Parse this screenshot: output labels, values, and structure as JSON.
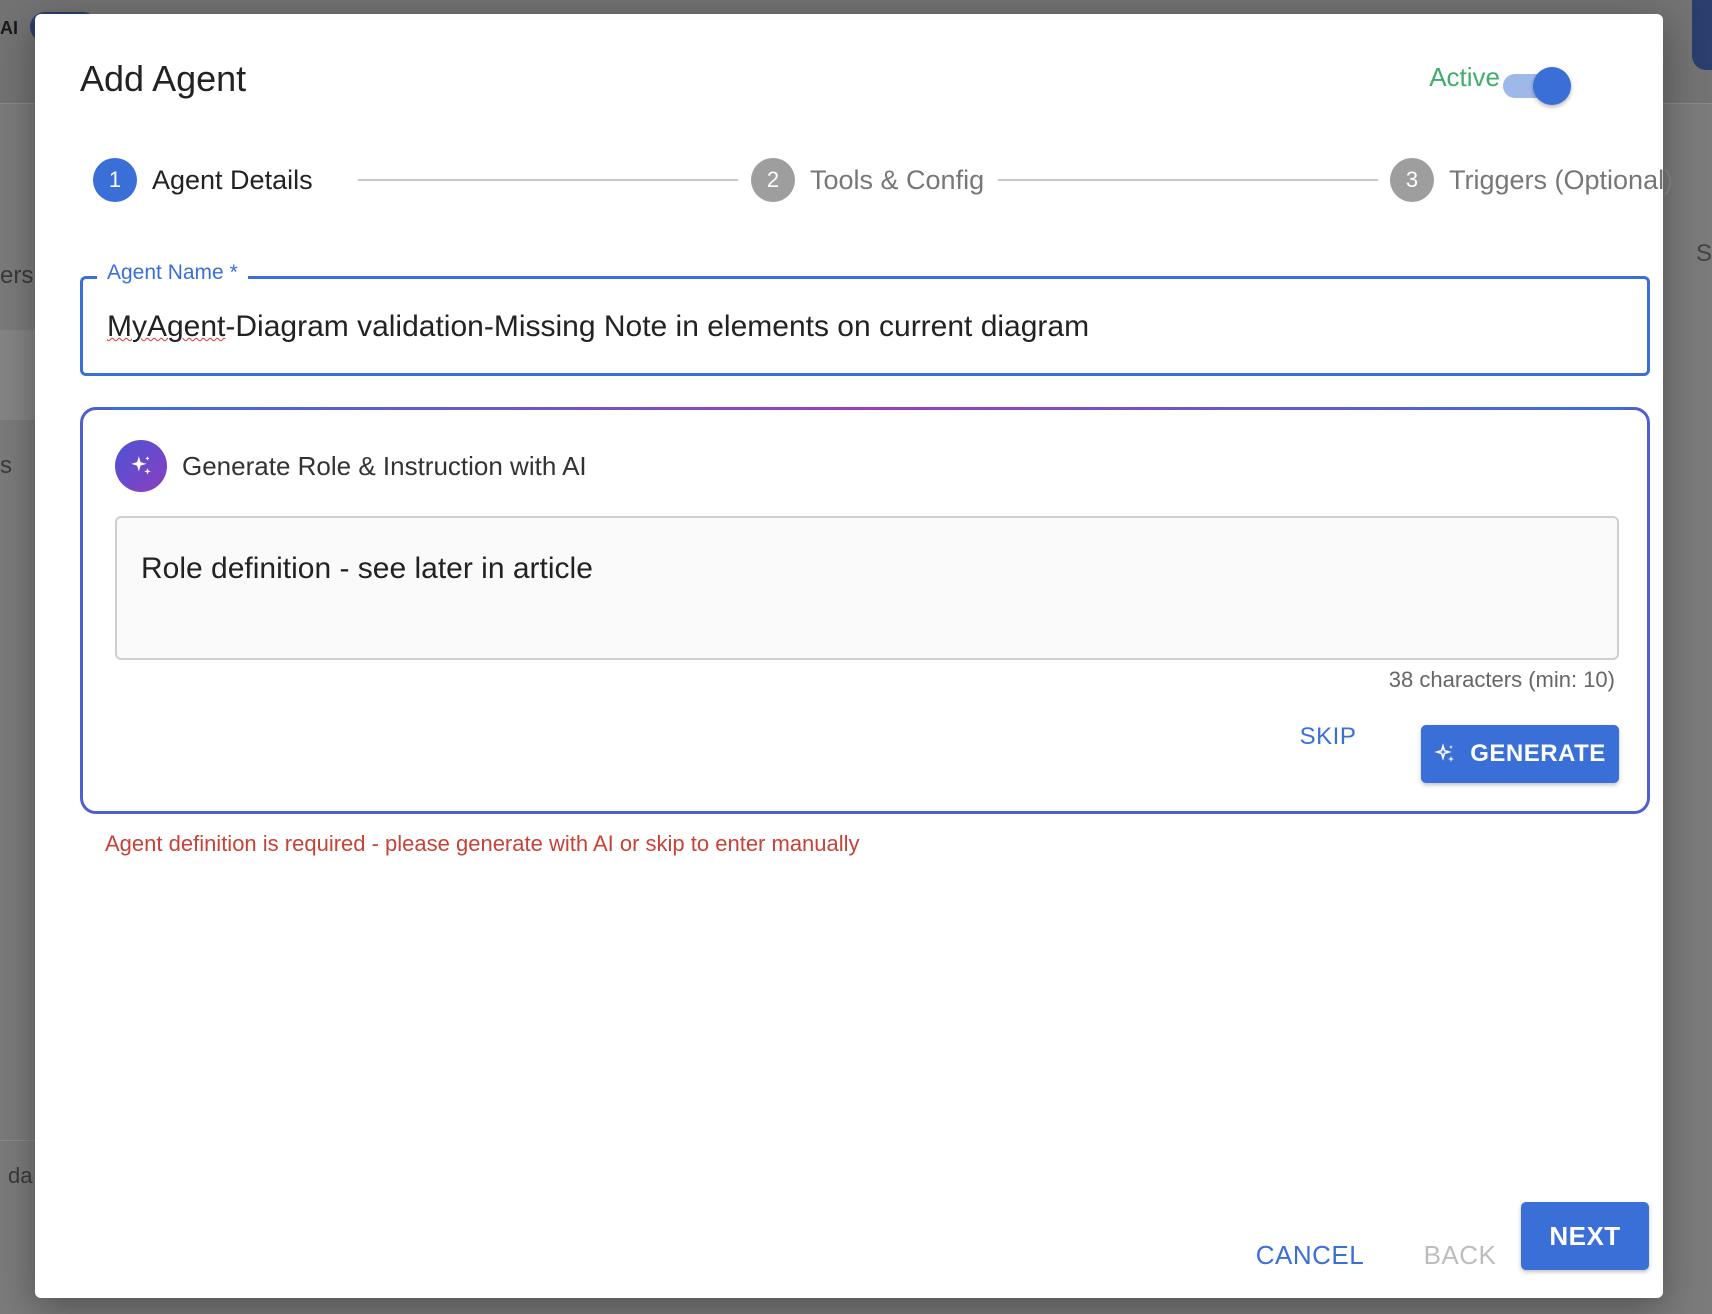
{
  "background": {
    "logo_text": "AI",
    "fragment_1": "ers",
    "fragment_2": "s",
    "fragment_3": "da",
    "fragment_right": "S"
  },
  "dialog": {
    "title": "Add Agent",
    "active_label": "Active",
    "active_toggle_on": true
  },
  "stepper": {
    "steps": [
      {
        "number": "1",
        "label": "Agent Details",
        "state": "active"
      },
      {
        "number": "2",
        "label": "Tools & Config",
        "state": "inactive"
      },
      {
        "number": "3",
        "label": "Triggers (Optional)",
        "state": "inactive"
      }
    ]
  },
  "agent_name": {
    "label": "Agent Name *",
    "value_misspelled_part": "MyAgent",
    "value_rest": "-Diagram validation-Missing Note in elements on current diagram"
  },
  "ai_panel": {
    "title": "Generate Role & Instruction with AI",
    "input_value": "Role definition - see later in article",
    "char_count": "38 characters (min: 10)",
    "skip_label": "SKIP",
    "generate_label": "GENERATE",
    "icon": "sparkle-icon"
  },
  "error_message": "Agent definition is required - please generate with AI or skip to enter manually",
  "footer": {
    "cancel_label": "CANCEL",
    "back_label": "BACK",
    "next_label": "NEXT"
  },
  "colors": {
    "primary": "#3a6fd8",
    "active_green": "#3fae6a",
    "error": "#c84238"
  }
}
